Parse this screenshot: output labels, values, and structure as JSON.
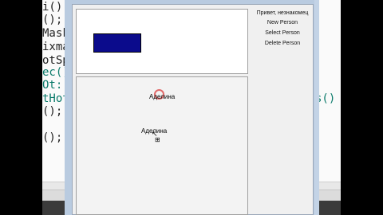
{
  "code": {
    "lines": [
      "i();",
      "();",
      "Mask",
      "ixma",
      "otSp",
      "ec()",
      "Ot::",
      "tHot",
      "();",
      "();"
    ],
    "right_fragment": "s()"
  },
  "canvas": {
    "person1_name": "Аделина",
    "person2_name": "Аделина"
  },
  "menu": {
    "greeting": "Привет, незнакомец",
    "new_person": "New Person",
    "select_person": "Select Person",
    "delete_person": "Delete Person"
  },
  "colors": {
    "rect_fill": "#0b0b8c",
    "highlight_ring": "#e06a6a"
  },
  "icons": {
    "cursor": "arrow-cursor-icon",
    "move": "move-cross-icon"
  }
}
